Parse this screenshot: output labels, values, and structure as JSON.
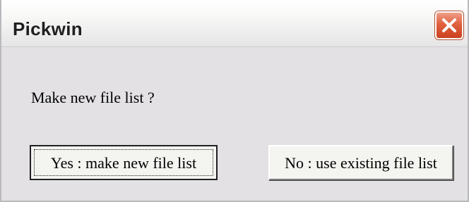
{
  "window": {
    "title": "Pickwin",
    "close_icon": "close-icon"
  },
  "dialog": {
    "message": "Make new file list ?",
    "yes_button_label": "Yes : make new file list",
    "no_button_label": "No : use existing file list"
  },
  "colors": {
    "close_button": "#e0603e",
    "dialog_background": "#e3e1e4"
  }
}
